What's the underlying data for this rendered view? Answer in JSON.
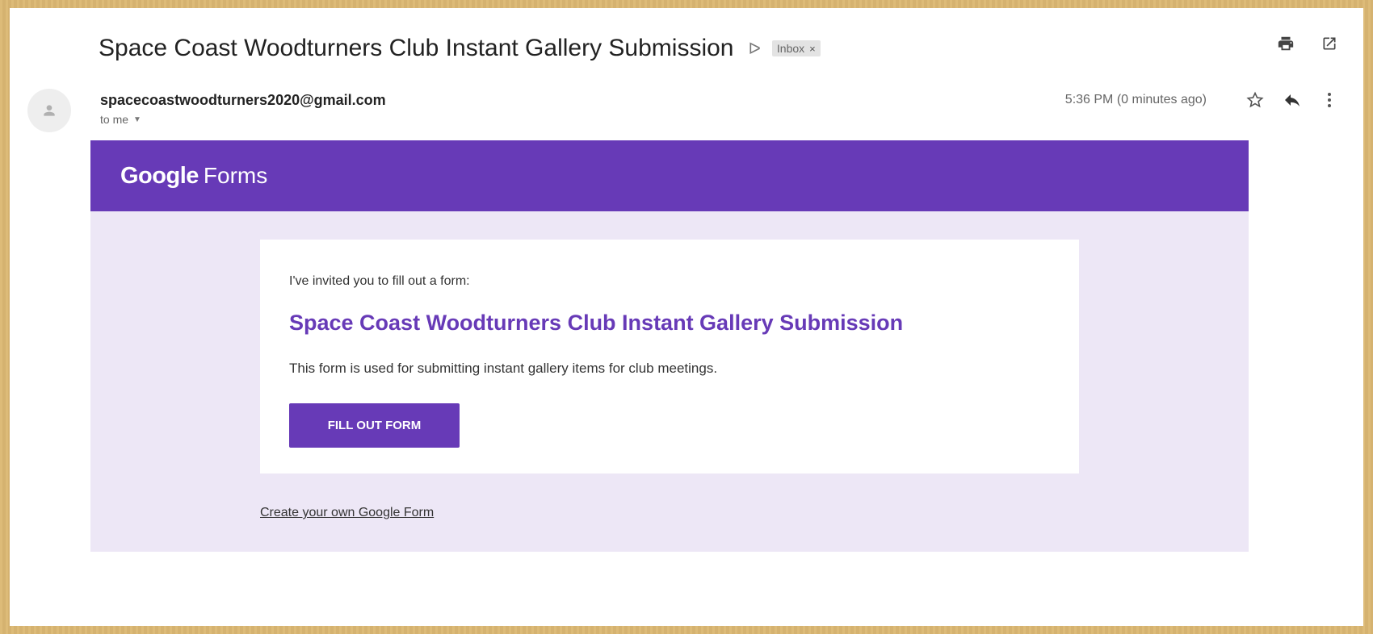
{
  "email": {
    "subject": "Space Coast Woodturners Club Instant Gallery Submission",
    "label": "Inbox",
    "label_remove": "×",
    "sender": "spacecoastwoodturners2020@gmail.com",
    "recipient": "to me",
    "timestamp": "5:36 PM (0 minutes ago)"
  },
  "form_email": {
    "brand_google": "Google",
    "brand_forms": "Forms",
    "invite_text": "I've invited you to fill out a form:",
    "form_title": "Space Coast Woodturners Club Instant Gallery Submission",
    "form_description": "This form is used for submitting instant gallery items for club meetings.",
    "fill_button_label": "FILL OUT FORM",
    "create_link": "Create your own Google Form"
  },
  "icons": {
    "important": "important-marker-icon",
    "print": "print-icon",
    "open_new_window": "open-in-new-window-icon",
    "avatar": "person-icon",
    "star": "star-icon",
    "reply": "reply-icon",
    "more": "more-vert-icon",
    "recipient_details": "chevron-down-icon"
  },
  "colors": {
    "brand_purple": "#673ab7",
    "card_background": "#ede7f6"
  }
}
